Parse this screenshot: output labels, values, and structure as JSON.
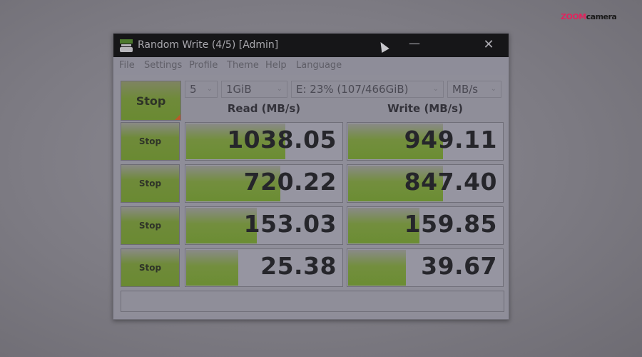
{
  "watermark": {
    "part1": "ZOOM",
    "part2": "camera"
  },
  "window": {
    "title": "Random Write (4/5) [Admin]",
    "minimize_glyph": "—",
    "close_glyph": "✕"
  },
  "menu": [
    "File",
    "Settings",
    "Profile",
    "Theme",
    "Help",
    "Language"
  ],
  "toolbar": {
    "all_button_label": "Stop",
    "count": "5",
    "size": "1GiB",
    "drive": "E: 23% (107/466GiB)",
    "unit": "MB/s",
    "chevron": "⌄"
  },
  "headers": {
    "read": "Read (MB/s)",
    "write": "Write (MB/s)"
  },
  "rows": [
    {
      "button": "Stop",
      "read": "1038.05",
      "write": "949.11",
      "read_fill_pct": 63,
      "write_fill_pct": 61
    },
    {
      "button": "Stop",
      "read": "720.22",
      "write": "847.40",
      "read_fill_pct": 60,
      "write_fill_pct": 61
    },
    {
      "button": "Stop",
      "read": "153.03",
      "write": "159.85",
      "read_fill_pct": 45,
      "write_fill_pct": 46
    },
    {
      "button": "Stop",
      "read": "25.38",
      "write": "39.67",
      "read_fill_pct": 33,
      "write_fill_pct": 37
    }
  ],
  "status_text": ""
}
